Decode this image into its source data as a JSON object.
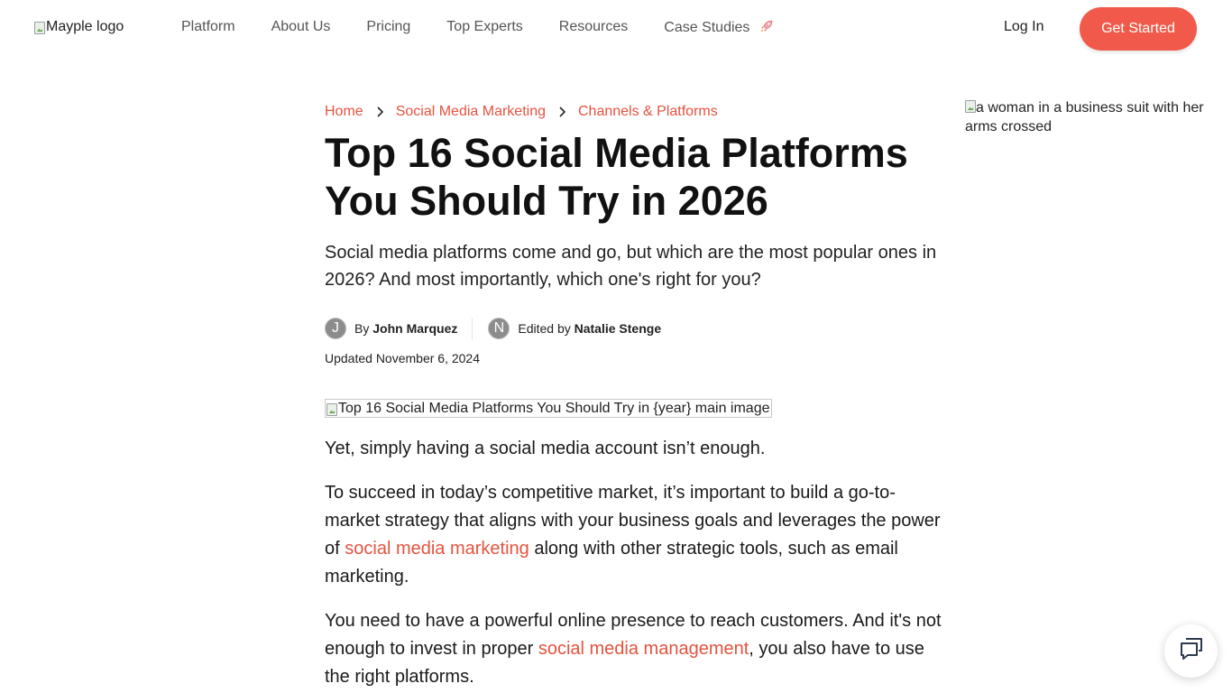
{
  "header": {
    "logo_alt": "Mayple logo",
    "nav": [
      {
        "label": "Platform"
      },
      {
        "label": "About Us"
      },
      {
        "label": "Pricing"
      },
      {
        "label": "Top Experts"
      },
      {
        "label": "Resources"
      },
      {
        "label": "Case Studies"
      }
    ],
    "case_studies_icon": "rocket-icon",
    "login_label": "Log In",
    "cta_label": "Get Started"
  },
  "breadcrumb": [
    {
      "label": "Home"
    },
    {
      "label": "Social Media Marketing"
    },
    {
      "label": "Channels & Platforms"
    }
  ],
  "article": {
    "title": "Top 16 Social Media Platforms You Should Try in 2026",
    "subtitle": "Social media platforms come and go, but which are the most popular ones in 2026? And most importantly, which one's right for you?",
    "author": {
      "initial": "J",
      "prefix": "By",
      "name": "John Marquez"
    },
    "editor": {
      "initial": "N",
      "prefix": "Edited by",
      "name": "Natalie Stenge"
    },
    "updated": "Updated November 6, 2024",
    "main_image_alt": "Top 16 Social Media Platforms You Should Try in {year} main image",
    "paragraphs": {
      "p1": "Yet, simply having a social media account isn’t enough.",
      "p2_a": "To succeed in today’s competitive market, it’s important to build a go-to-market strategy that aligns with your business goals and leverages the power of ",
      "p2_link": "social media marketing",
      "p2_b": " along with other strategic tools, such as email marketing.",
      "p3_a": "You need to have a powerful online presence to reach customers. And it's not enough to invest in proper ",
      "p3_link": "social media management",
      "p3_b": ", you also have to use the right platforms."
    }
  },
  "sidebar": {
    "image_alt": "a woman in a business suit with her arms crossed"
  },
  "chat_widget": {
    "icon": "chat-bubbles-icon"
  },
  "colors": {
    "accent": "#f15a4a",
    "link": "#e5533f"
  }
}
